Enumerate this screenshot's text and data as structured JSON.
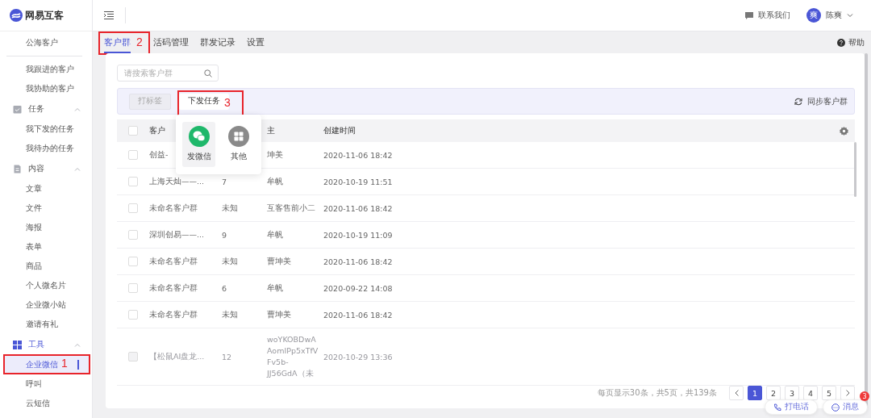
{
  "logo": {
    "text": "网易互客"
  },
  "sidebar": {
    "items": [
      {
        "kind": "link",
        "label": "公海客户",
        "selected": false
      },
      {
        "kind": "divider"
      },
      {
        "kind": "link",
        "label": "我跟进的客户",
        "selected": false
      },
      {
        "kind": "link",
        "label": "我协助的客户",
        "selected": false
      },
      {
        "kind": "section",
        "label": "任务",
        "expanded": true,
        "active": false,
        "children": [
          {
            "label": "我下发的任务",
            "selected": false
          },
          {
            "label": "我待办的任务",
            "selected": false
          }
        ]
      },
      {
        "kind": "section",
        "label": "内容",
        "expanded": true,
        "active": false,
        "children": [
          {
            "label": "文章",
            "selected": false
          },
          {
            "label": "文件",
            "selected": false
          },
          {
            "label": "海报",
            "selected": false
          },
          {
            "label": "表单",
            "selected": false
          },
          {
            "label": "商品",
            "selected": false
          },
          {
            "label": "个人微名片",
            "selected": false
          },
          {
            "label": "企业微小站",
            "selected": false
          },
          {
            "label": "邀请有礼",
            "selected": false
          }
        ]
      },
      {
        "kind": "section",
        "label": "工具",
        "expanded": true,
        "active": true,
        "children": [
          {
            "label": "企业微信",
            "selected": true,
            "callout": "1"
          },
          {
            "label": "呼叫",
            "selected": false
          },
          {
            "label": "云短信",
            "selected": false
          }
        ]
      }
    ]
  },
  "header": {
    "contact": "联系我们",
    "avatar": "爽",
    "user": "陈爽"
  },
  "tabs": [
    {
      "label": "客户群",
      "selected": true,
      "callout": "2"
    },
    {
      "label": "活码管理",
      "selected": false
    },
    {
      "label": "群发记录",
      "selected": false
    },
    {
      "label": "设置",
      "selected": false
    }
  ],
  "help": "帮助",
  "search": {
    "placeholder": "请搜索客户群"
  },
  "toolbar": {
    "tag_button": {
      "label": "打标签",
      "disabled": true
    },
    "task_button": {
      "label": "下发任务",
      "callout": "3"
    },
    "sync": "同步客户群"
  },
  "popover": {
    "items": [
      {
        "kind": "wechat",
        "label": "发微信",
        "selected": true
      },
      {
        "kind": "other",
        "label": "其他",
        "selected": false
      }
    ]
  },
  "table": {
    "select_all": {
      "checked": false
    },
    "columns": [
      "客户",
      "",
      "主",
      "创建时间"
    ],
    "rows": [
      {
        "name": "创益-",
        "count": "",
        "owner": "坤美",
        "created": "2020-11-06 18:42",
        "disabled": false,
        "checked": false
      },
      {
        "name": "上海天灿——...",
        "count": "7",
        "owner": "牟帆",
        "created": "2020-10-19 11:51",
        "disabled": false,
        "checked": false
      },
      {
        "name": "未命名客户群",
        "count": "未知",
        "owner": "互客售前小二",
        "created": "2020-11-06 18:42",
        "disabled": false,
        "checked": false
      },
      {
        "name": "深圳创易——...",
        "count": "9",
        "owner": "牟帆",
        "created": "2020-10-19 11:09",
        "disabled": false,
        "checked": false
      },
      {
        "name": "未命名客户群",
        "count": "未知",
        "owner": "曹坤美",
        "created": "2020-11-06 18:42",
        "disabled": false,
        "checked": false
      },
      {
        "name": "未命名客户群",
        "count": "6",
        "owner": "牟帆",
        "created": "2020-09-22 14:08",
        "disabled": false,
        "checked": false
      },
      {
        "name": "未命名客户群",
        "count": "未知",
        "owner": "曹坤美",
        "created": "2020-11-06 18:42",
        "disabled": false,
        "checked": false
      },
      {
        "name": "【松鼠AI盘龙...",
        "count": "12",
        "owner": "woYKOBDwA AomIPp5xTfV Fv5b- JJ56GdA（未",
        "created": "2020-10-29 13:36",
        "disabled": true,
        "checked": false
      }
    ]
  },
  "pagination": {
    "summary": "每页显示30条，共5页，共139条",
    "pages": [
      {
        "label": "1",
        "selected": true
      },
      {
        "label": "2",
        "selected": false
      },
      {
        "label": "3",
        "selected": false
      },
      {
        "label": "4",
        "selected": false
      },
      {
        "label": "5",
        "selected": false
      }
    ]
  },
  "float_buttons": {
    "call": "打电话",
    "message": "消息",
    "badge": "3"
  }
}
